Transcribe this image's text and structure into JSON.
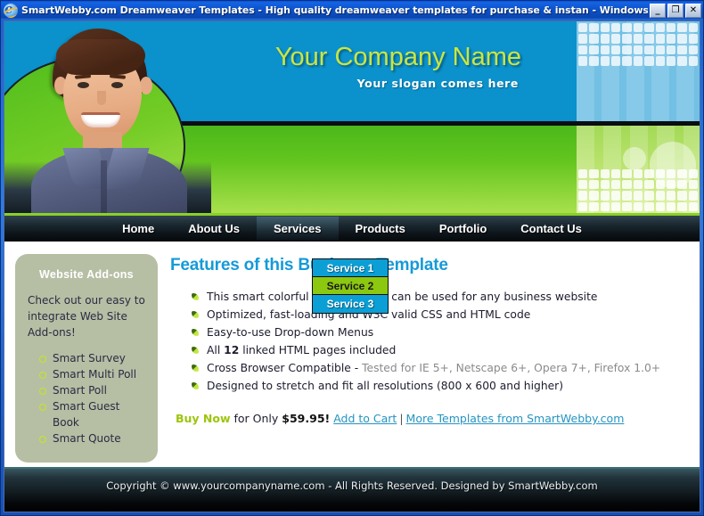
{
  "window": {
    "title": "SmartWebby.com Dreamweaver Templates - High quality dreamweaver templates for purchase & instan - Windows Interne...",
    "icon": "internet-explorer-icon",
    "buttons": {
      "minimize": "_",
      "maximize": "❐",
      "close": "✕"
    }
  },
  "header": {
    "company_name": "Your Company Name",
    "slogan": "Your slogan comes here",
    "colors": {
      "blue": "#0b91cb",
      "green": "#63c51e",
      "title_yellow": "#cbe540"
    }
  },
  "nav": {
    "items": [
      {
        "label": "Home",
        "active": false
      },
      {
        "label": "About Us",
        "active": false
      },
      {
        "label": "Services",
        "active": true
      },
      {
        "label": "Products",
        "active": false
      },
      {
        "label": "Portfolio",
        "active": false
      },
      {
        "label": "Contact Us",
        "active": false
      }
    ]
  },
  "dropdown": {
    "open_for": "Services",
    "items": [
      {
        "label": "Service 1",
        "highlighted": false
      },
      {
        "label": "Service 2",
        "highlighted": true
      },
      {
        "label": "Service 3",
        "highlighted": false
      }
    ],
    "colors": {
      "normal_bg": "#0b9fd6",
      "highlight_bg": "#8cc80f"
    }
  },
  "sidebar": {
    "title": "Website Add-ons",
    "description": "Check out our easy to integrate Web Site Add-ons!",
    "items": [
      {
        "label": "Smart Survey"
      },
      {
        "label": "Smart Multi Poll"
      },
      {
        "label": "Smart Poll"
      },
      {
        "label": "Smart Guest Book"
      },
      {
        "label": "Smart Quote"
      }
    ]
  },
  "main": {
    "heading": "Features of this Business Template",
    "features": [
      {
        "text": "This smart colorful web template can be used for any business website"
      },
      {
        "text": "Optimized, fast-loading and W3C valid CSS and HTML code"
      },
      {
        "text": "Easy-to-use Drop-down Menus"
      },
      {
        "prefix": "All ",
        "bold": "12",
        "suffix": " linked HTML pages included"
      },
      {
        "prefix": "Cross Browser Compatible - ",
        "muted": "Tested for IE 5+, Netscape 6+, Opera 7+, Firefox 1.0+"
      },
      {
        "text": "Designed to stretch and fit all resolutions (800 x 600 and higher)"
      }
    ],
    "buy": {
      "buy_now": "Buy Now",
      "for_only": " for Only ",
      "price": "$59.95!",
      "add_to_cart": "Add to Cart",
      "separator": "|",
      "more_templates": "More Templates from SmartWebby.com"
    }
  },
  "footer": {
    "copyright": "Copyright © www.yourcompanyname.com - All Rights Reserved. Designed by SmartWebby.com"
  }
}
